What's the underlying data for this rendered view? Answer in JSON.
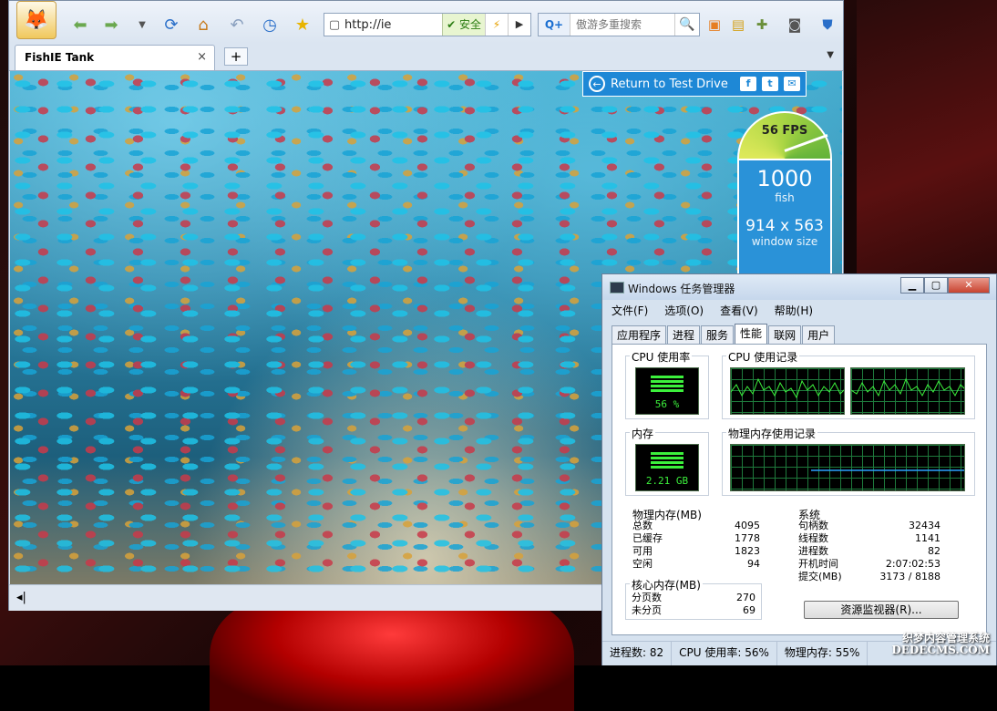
{
  "browser": {
    "address": "http://ie",
    "safe_label": "安全",
    "search_placeholder": "傲游多重搜索",
    "tab_title": "FishIE Tank",
    "tab_close": "×",
    "new_tab": "+"
  },
  "fish_tank": {
    "banner": "Return to Test Drive",
    "fps_label": "56 FPS",
    "fps": 56,
    "fish_count": "1000",
    "fish_label": "fish",
    "window_size": "914 x 563",
    "window_size_label": "window size"
  },
  "taskmgr": {
    "title": "Windows 任务管理器",
    "menu": [
      "文件(F)",
      "选项(O)",
      "查看(V)",
      "帮助(H)"
    ],
    "tabs": [
      "应用程序",
      "进程",
      "服务",
      "性能",
      "联网",
      "用户"
    ],
    "active_tab": "性能",
    "cpu_usage_title": "CPU 使用率",
    "cpu_usage_value": "56 %",
    "cpu_history_title": "CPU 使用记录",
    "mem_title": "内存",
    "mem_value": "2.21 GB",
    "mem_history_title": "物理内存使用记录",
    "physical_mem": {
      "title": "物理内存(MB)",
      "rows": [
        {
          "label": "总数",
          "value": "4095"
        },
        {
          "label": "已缓存",
          "value": "1778"
        },
        {
          "label": "可用",
          "value": "1823"
        },
        {
          "label": "空闲",
          "value": "94"
        }
      ]
    },
    "kernel_mem": {
      "title": "核心内存(MB)",
      "rows": [
        {
          "label": "分页数",
          "value": "270"
        },
        {
          "label": "未分页",
          "value": "69"
        }
      ]
    },
    "system": {
      "title": "系统",
      "rows": [
        {
          "label": "句柄数",
          "value": "32434"
        },
        {
          "label": "线程数",
          "value": "1141"
        },
        {
          "label": "进程数",
          "value": "82"
        },
        {
          "label": "开机时间",
          "value": "2:07:02:53"
        },
        {
          "label": "提交(MB)",
          "value": "3173 / 8188"
        }
      ]
    },
    "resource_monitor_button": "资源监视器(R)...",
    "status": {
      "processes": "进程数: 82",
      "cpu": "CPU 使用率: 56%",
      "memory": "物理内存: 55%"
    }
  },
  "watermark": {
    "line1": "织梦内容管理系统",
    "line2": "DEDECMS.COM"
  }
}
